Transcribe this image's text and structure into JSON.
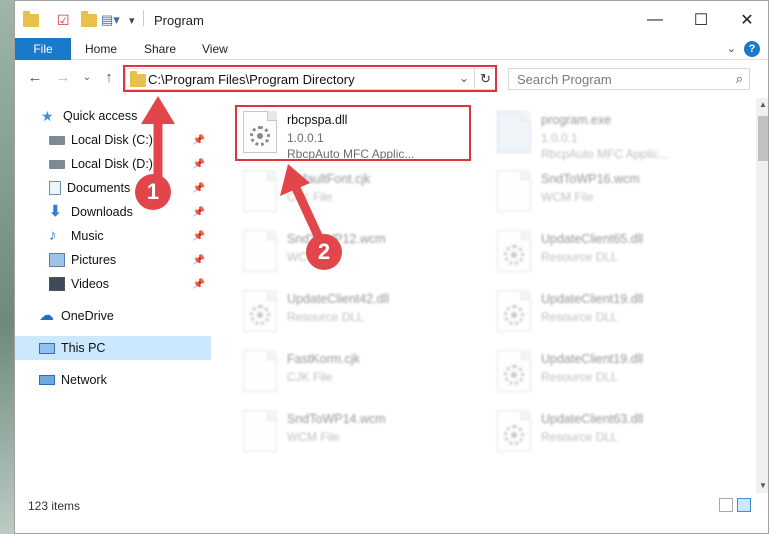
{
  "window": {
    "title": "Program",
    "controls": {
      "minimize": "—",
      "maximize": "☐",
      "close": "✕"
    }
  },
  "ribbon": {
    "tabs": [
      "File",
      "Home",
      "Share",
      "View"
    ],
    "help": "?"
  },
  "address": {
    "path": "C:\\Program Files\\Program Directory",
    "search_placeholder": "Search Program"
  },
  "sidebar": {
    "items": [
      {
        "label": "Quick access",
        "icon": "star-icon",
        "color": "#3a8ee6"
      },
      {
        "label": "Local Disk (C:)",
        "icon": "drive-icon",
        "pinned": true
      },
      {
        "label": "Local Disk (D:)",
        "icon": "drive-icon",
        "pinned": true
      },
      {
        "label": "Documents",
        "icon": "documents-icon",
        "pinned": true
      },
      {
        "label": "Downloads",
        "icon": "downloads-icon",
        "pinned": true
      },
      {
        "label": "Music",
        "icon": "music-icon",
        "pinned": true
      },
      {
        "label": "Pictures",
        "icon": "pictures-icon",
        "pinned": true
      },
      {
        "label": "Videos",
        "icon": "videos-icon",
        "pinned": true
      },
      {
        "label": "OneDrive",
        "icon": "cloud-icon"
      },
      {
        "label": "This PC",
        "icon": "computer-icon",
        "selected": true
      },
      {
        "label": "Network",
        "icon": "network-icon"
      }
    ]
  },
  "files": [
    {
      "name": "rbcpspa.dll",
      "line2": "1.0.0.1",
      "line3": "RbcpAuto MFC Applic...",
      "highlighted": true
    },
    {
      "name": "program.exe",
      "line2": "1.0.0.1",
      "line3": "RbcpAuto MFC Applic..."
    },
    {
      "name": "DefaultFont.cjk",
      "line2": "CJK File"
    },
    {
      "name": "SndToWP16.wcm",
      "line2": "WCM File"
    },
    {
      "name": "SndToWP12.wcm",
      "line2": "WCM File"
    },
    {
      "name": "UpdateClient65.dll",
      "line2": "Resource DLL"
    },
    {
      "name": "UpdateClient42.dll",
      "line2": "Resource DLL"
    },
    {
      "name": "UpdateClient19.dll",
      "line2": "Resource DLL"
    },
    {
      "name": "FastKorm.cjk",
      "line2": "CJK File"
    },
    {
      "name": "UpdateClient19.dll",
      "line2": "Resource DLL"
    },
    {
      "name": "SndToWP14.wcm",
      "line2": "WCM File"
    },
    {
      "name": "UpdateClient63.dll",
      "line2": "Resource DLL"
    }
  ],
  "status": {
    "item_count": "123 items"
  },
  "annotations": {
    "step1": "1",
    "step2": "2",
    "color": "#e2464b"
  }
}
